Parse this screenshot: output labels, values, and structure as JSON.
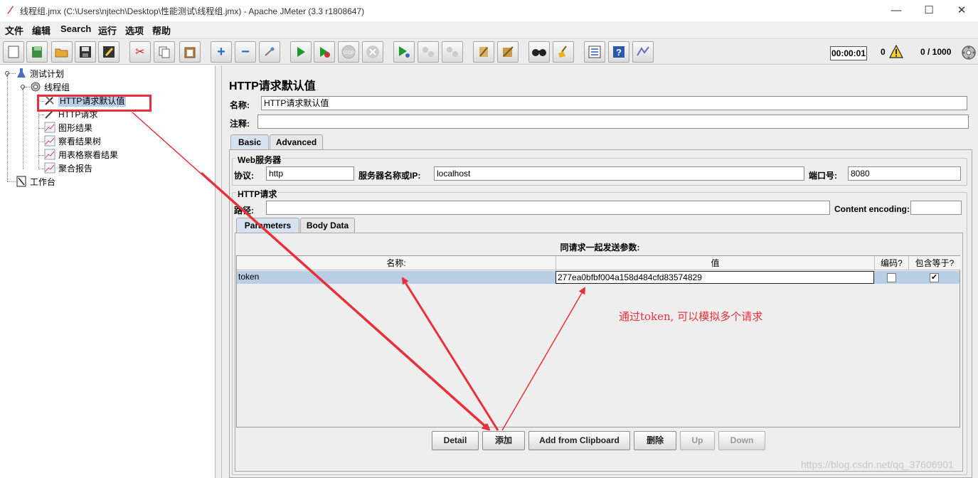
{
  "window": {
    "title": "线程组.jmx (C:\\Users\\njtech\\Desktop\\性能测试\\线程组.jmx) - Apache JMeter (3.3 r1808647)",
    "minimize": "—",
    "maximize": "☐",
    "close": "✕"
  },
  "menubar": [
    "文件",
    "编辑",
    "Search",
    "运行",
    "选项",
    "帮助"
  ],
  "toolbar": {
    "timer": "00:00:01",
    "error_count": "0",
    "threads": "0 / 1000",
    "buttons": [
      "new-icon",
      "templates-icon",
      "open-icon",
      "save-icon",
      "save-as-icon",
      "cut-icon",
      "copy-icon",
      "paste-icon",
      "expand-icon",
      "collapse-icon",
      "toggle-icon",
      "start-icon",
      "start-no-pause-icon",
      "stop-icon",
      "shutdown-icon",
      "remote-start-icon",
      "remote-stop-icon",
      "remote-shutdown-icon",
      "clear-icon",
      "clear-all-icon",
      "search-icon",
      "reset-search-icon",
      "function-helper-icon",
      "help-icon",
      "log-icon"
    ]
  },
  "tree": {
    "root": "测试计划",
    "thread_group": "线程组",
    "children": [
      "HTTP请求默认值",
      "HTTP请求",
      "图形结果",
      "察看结果树",
      "用表格察看结果",
      "聚合报告"
    ],
    "workbench": "工作台"
  },
  "panel": {
    "title": "HTTP请求默认值",
    "name_label": "名称:",
    "name_value": "HTTP请求默认值",
    "comment_label": "注释:",
    "comment_value": "",
    "tabs": [
      "Basic",
      "Advanced"
    ],
    "web_server": {
      "legend": "Web服务器",
      "protocol_label": "协议:",
      "protocol_value": "http",
      "server_label": "服务器名称或IP:",
      "server_value": "localhost",
      "port_label": "端口号:",
      "port_value": "8080"
    },
    "http_request": {
      "legend": "HTTP请求",
      "path_label": "路径:",
      "path_value": "",
      "encoding_label": "Content encoding:",
      "encoding_value": ""
    },
    "param_tabs": [
      "Parameters",
      "Body Data"
    ],
    "params_caption": "同请求一起发送参数:",
    "columns": [
      "名称:",
      "值",
      "编码?",
      "包含等于?"
    ],
    "rows": [
      {
        "name": "token",
        "value": "277ea0bfbf004a158d484cfd83574829",
        "encode": false,
        "include_equals": true
      }
    ],
    "buttons": [
      "Detail",
      "添加",
      "Add from Clipboard",
      "删除",
      "Up",
      "Down"
    ]
  },
  "annotation": {
    "text": "通过token, 可以模拟多个请求",
    "color": "#e8303a"
  },
  "watermark": "https://blog.csdn.net/qq_37606901"
}
